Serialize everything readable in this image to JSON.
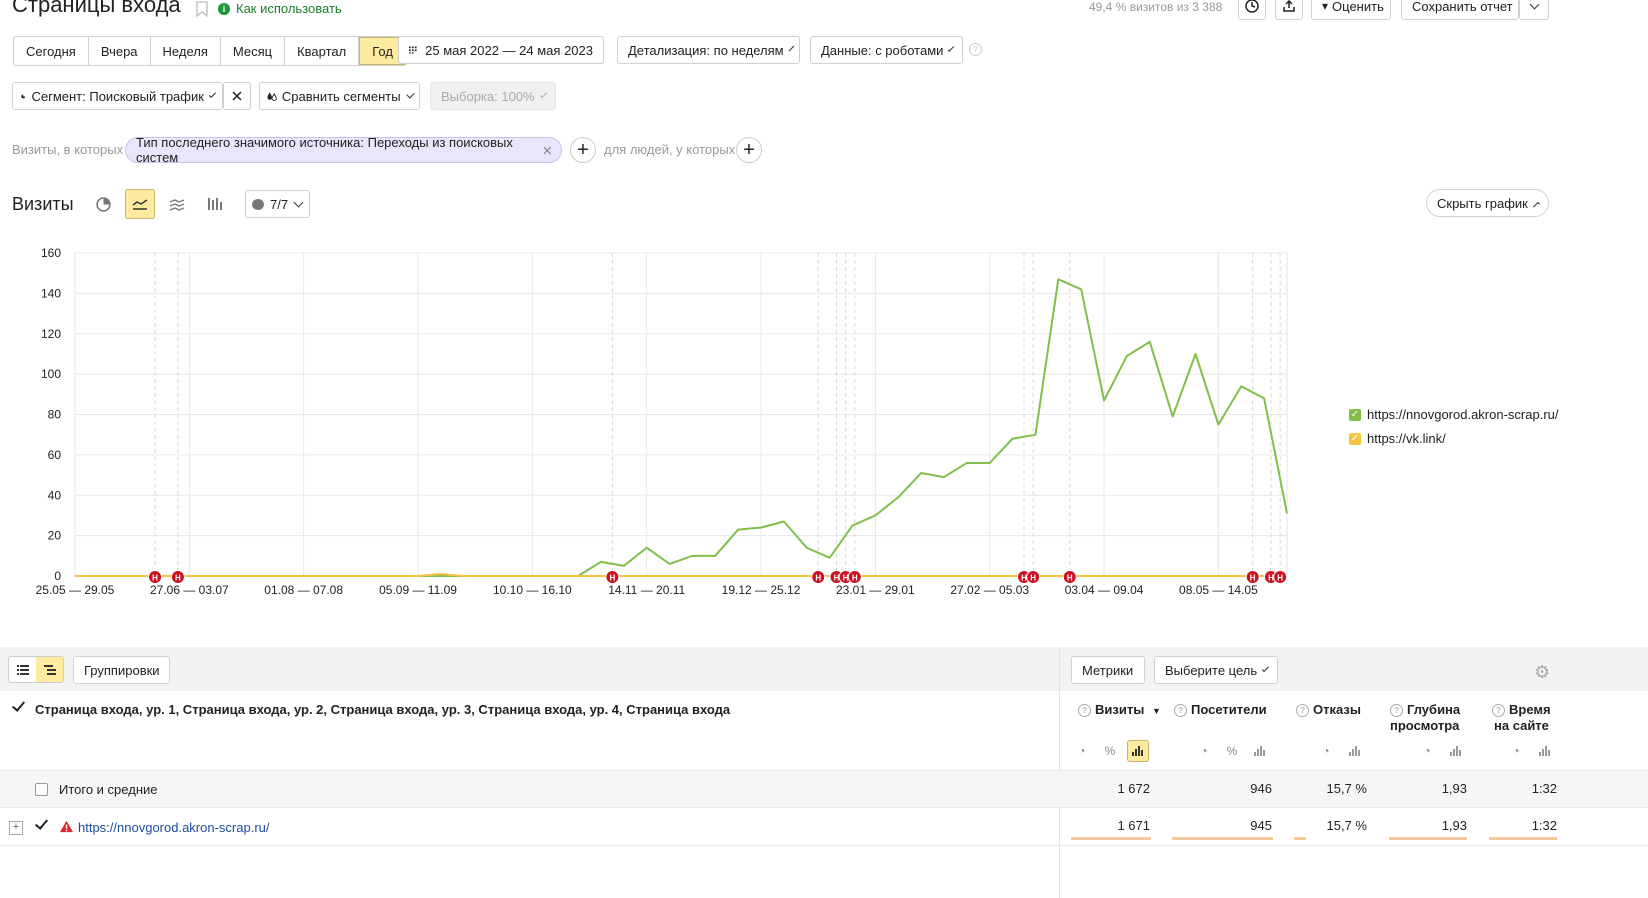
{
  "page": {
    "title": "Страницы входа",
    "how_to": "Как использовать",
    "sample_info": "49,4 % визитов из 3 388",
    "rate_label": "Оценить",
    "save_report_label": "Сохранить отчет"
  },
  "period": {
    "options": [
      "Сегодня",
      "Вчера",
      "Неделя",
      "Месяц",
      "Квартал",
      "Год"
    ],
    "active": "Год",
    "date_range": "25 мая 2022 — 24 мая 2023",
    "detail_label": "Детализация: по неделям",
    "data_label": "Данные: с роботами"
  },
  "segment": {
    "label": "Сегмент: Поисковый трафик",
    "compare_label": "Сравнить сегменты",
    "sample_label": "Выборка: 100%"
  },
  "filters": {
    "visits_prefix": "Визиты, в которых",
    "chip": "Тип последнего значимого источника: Переходы из поисковых систем",
    "people_prefix": "для людей, у которых"
  },
  "chart_header": {
    "title": "Визиты",
    "series_count": "7/7",
    "hide_chart": "Скрыть график"
  },
  "chart_data": {
    "type": "line",
    "x_tick_labels": [
      "25.05 — 29.05",
      "27.06 — 03.07",
      "01.08 — 07.08",
      "05.09 — 11.09",
      "10.10 — 16.10",
      "14.11 — 20.11",
      "19.12 — 25.12",
      "23.01 — 29.01",
      "27.02 — 05.03",
      "03.04 — 09.04",
      "08.05 — 14.05"
    ],
    "y_ticks": [
      0,
      20,
      40,
      60,
      80,
      100,
      120,
      140,
      160
    ],
    "ylim": [
      0,
      160
    ],
    "week_count": 53,
    "grid": true,
    "legend_position": "right",
    "series": [
      {
        "name": "https://nnovgorod.akron-scrap.ru/",
        "color": "#7fbf4a",
        "values": [
          0,
          0,
          0,
          0,
          0,
          0,
          0,
          0,
          0,
          0,
          0,
          0,
          0,
          0,
          0,
          0,
          0,
          0,
          0,
          0,
          0,
          0,
          0,
          7,
          5,
          14,
          6,
          10,
          10,
          23,
          24,
          27,
          14,
          9,
          25,
          30,
          39,
          51,
          49,
          56,
          56,
          68,
          70,
          147,
          142,
          87,
          109,
          116,
          79,
          110,
          75,
          94,
          88,
          31
        ]
      },
      {
        "name": "https://vk.link/",
        "color": "#f5c542",
        "values": [
          0,
          0,
          0,
          0,
          0,
          0,
          0,
          0,
          0,
          0,
          0,
          0,
          0,
          0,
          0,
          0,
          1,
          0,
          0,
          0,
          0,
          0,
          0,
          0,
          0,
          0,
          0,
          0,
          0,
          0,
          0,
          0,
          0,
          0,
          0,
          0,
          0,
          0,
          0,
          0,
          0,
          0,
          0,
          0,
          0,
          0,
          0,
          0,
          0,
          0,
          0,
          0,
          0,
          0
        ]
      }
    ],
    "annotations": {
      "label": "Н",
      "color": "#cc1122",
      "weeks": [
        3.5,
        4.5,
        23.5,
        32.5,
        33.3,
        33.7,
        34.1,
        41.5,
        41.9,
        43.5,
        51.5,
        52.3,
        52.7
      ]
    }
  },
  "table_toolbar": {
    "groupings": "Группировки",
    "metrics": "Метрики",
    "goal": "Выберите цель"
  },
  "table": {
    "dimension_header": "Страница входа, ур. 1, Страница входа, ур. 2, Страница входа, ур. 3, Страница входа, ур. 4, Страница входа",
    "columns": [
      {
        "label": "Визиты",
        "sorted": "▼"
      },
      {
        "label": "Посетители"
      },
      {
        "label": "Отказы"
      },
      {
        "label": "Глубина",
        "label2": "просмотра"
      },
      {
        "label": "Время",
        "label2": "на сайте"
      }
    ],
    "totals": {
      "label": "Итого и средние",
      "values": [
        "1 672",
        "946",
        "15,7 %",
        "1,93",
        "1:32"
      ]
    },
    "rows": [
      {
        "expand": "+",
        "label": "https://nnovgorod.akron-scrap.ru/",
        "values": [
          "1 671",
          "945",
          "15,7 %",
          "1,93",
          "1:32"
        ],
        "fractions": [
          1.0,
          1.0,
          0.157,
          1.0,
          1.0
        ]
      }
    ]
  }
}
